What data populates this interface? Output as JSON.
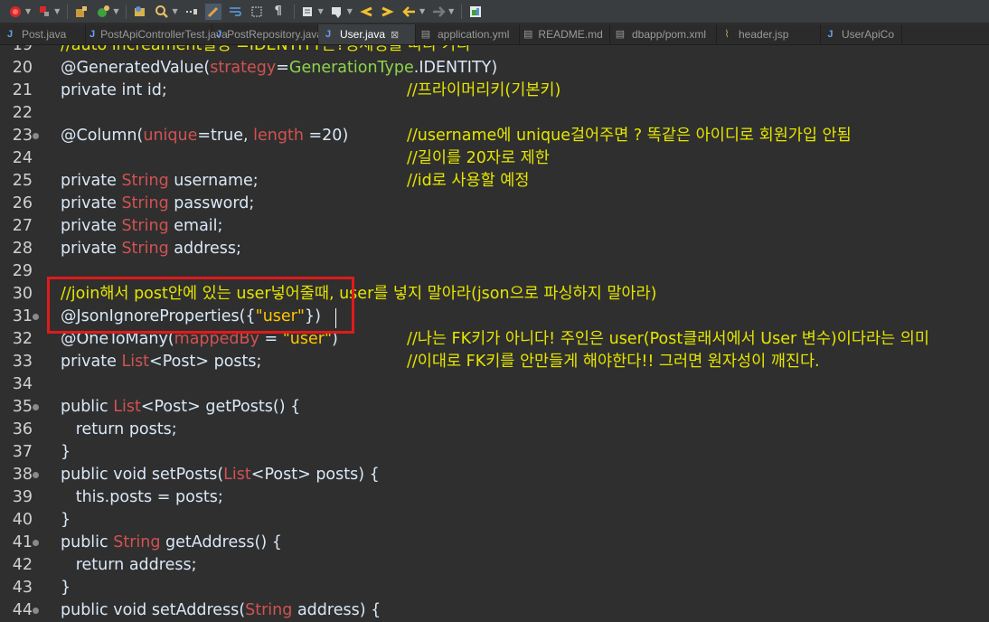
{
  "toolbar": {
    "buttons": [
      "debug-icon",
      "run-config-icon",
      "new-package-icon",
      "new-class-icon",
      "open-type-icon",
      "search-icon",
      "toggle-mark-icon",
      "highlight-icon",
      "word-wrap-icon",
      "block-select-icon",
      "show-whitespace-icon",
      "annotation-icon",
      "next-annotation-icon",
      "prev-edit-icon",
      "next-edit-icon",
      "back-icon",
      "forward-icon",
      "perspective-icon"
    ]
  },
  "tabs": [
    {
      "label": "Post.java",
      "kind": "java",
      "active": false
    },
    {
      "label": "PostApiControllerTest.java",
      "kind": "java",
      "active": false
    },
    {
      "label": "PostRepository.java",
      "kind": "java",
      "active": false
    },
    {
      "label": "User.java",
      "kind": "java",
      "active": true,
      "close": "⊠"
    },
    {
      "label": "application.yml",
      "kind": "file",
      "active": false
    },
    {
      "label": "README.md",
      "kind": "file",
      "active": false
    },
    {
      "label": "dbapp/pom.xml",
      "kind": "file",
      "active": false
    },
    {
      "label": "header.jsp",
      "kind": "jsp",
      "active": false
    },
    {
      "label": "UserApiCo",
      "kind": "java",
      "active": false
    }
  ],
  "editor": {
    "lines": [
      {
        "n": "19",
        "code": "//auto increament설정 =IDENTITY는?정세정을 따라 가라",
        "comment": ""
      },
      {
        "n": "20",
        "code": "@GeneratedValue(strategy=GenerationType.IDENTITY)",
        "comment": ""
      },
      {
        "n": "21",
        "code": "private int id;",
        "comment": "//프라이머리키(기본키)"
      },
      {
        "n": "22",
        "code": "",
        "comment": ""
      },
      {
        "n": "23",
        "code": "@Column(unique=true, length =20)",
        "comment": "//username에 unique걸어주면 ? 똑같은 아이디로 회원가입 안됨",
        "fold": true
      },
      {
        "n": "24",
        "code": "",
        "comment": "//길이를 20자로 제한"
      },
      {
        "n": "25",
        "code": "private String username;",
        "comment": "//id로 사용할 예정"
      },
      {
        "n": "26",
        "code": "private String password;",
        "comment": ""
      },
      {
        "n": "27",
        "code": "private String email;",
        "comment": ""
      },
      {
        "n": "28",
        "code": "private String address;",
        "comment": ""
      },
      {
        "n": "29",
        "code": "",
        "comment": ""
      },
      {
        "n": "30",
        "code": "//join해서 post안에 있는 user넣어줄때, user를 넣지 말아라(json으로 파싱하지 말아라)",
        "comment": ""
      },
      {
        "n": "31",
        "code": "@JsonIgnoreProperties({\"user\"})",
        "comment": "",
        "fold": true
      },
      {
        "n": "32",
        "code": "@OneToMany(mappedBy = \"user\")",
        "comment": "//나는 FK키가 아니다! 주인은 user(Post클래서에서 User 변수)이다라는 의미"
      },
      {
        "n": "33",
        "code": "private List<Post> posts;",
        "comment": "//이대로 FK키를 안만들게 해야한다!! 그러면 원자성이 깨진다."
      },
      {
        "n": "34",
        "code": "",
        "comment": ""
      },
      {
        "n": "35",
        "code": "public List<Post> getPosts() {",
        "comment": "",
        "fold": true
      },
      {
        "n": "36",
        "code": "   return posts;",
        "comment": ""
      },
      {
        "n": "37",
        "code": "}",
        "comment": ""
      },
      {
        "n": "38",
        "code": "public void setPosts(List<Post> posts) {",
        "comment": "",
        "fold": true
      },
      {
        "n": "39",
        "code": "   this.posts = posts;",
        "comment": ""
      },
      {
        "n": "40",
        "code": "}",
        "comment": ""
      },
      {
        "n": "41",
        "code": "public String getAddress() {",
        "comment": "",
        "fold": true
      },
      {
        "n": "42",
        "code": "   return address;",
        "comment": ""
      },
      {
        "n": "43",
        "code": "}",
        "comment": ""
      },
      {
        "n": "44",
        "code": "public void setAddress(String address) {",
        "comment": "",
        "fold": true
      }
    ]
  }
}
